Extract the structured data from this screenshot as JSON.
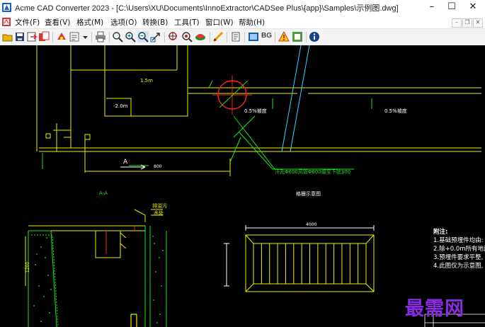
{
  "window": {
    "title": "Acme CAD Converter 2023 - [C:\\Users\\XU\\Documents\\InnoExtractor\\CADSee Plus\\{app}\\Samples\\示例图.dwg]",
    "minimize_glyph": "–",
    "maximize_glyph": "☐",
    "close_glyph": "✕"
  },
  "menu": {
    "items": [
      {
        "label": "文件(F)"
      },
      {
        "label": "查看(V)"
      },
      {
        "label": "格式(M)"
      },
      {
        "label": "选项(O)"
      },
      {
        "label": "转换(B)"
      },
      {
        "label": "工具(T)"
      },
      {
        "label": "窗口(W)"
      },
      {
        "label": "帮助(H)"
      }
    ],
    "mdi_controls": [
      "–",
      "❐",
      "✕"
    ]
  },
  "toolbar": {
    "icons": [
      "open-icon",
      "save-icon",
      "export-icon",
      "batch-icon",
      "print-preview-icon",
      "print-icon",
      "zoom-realtime-icon",
      "zoom-in-icon",
      "zoom-out-icon",
      "zoom-window-icon",
      "zoom-extent-icon",
      "pan-icon",
      "find-icon",
      "layer-icon",
      "text-icon",
      "measure-icon",
      "info-icon"
    ],
    "bg_label": "BG"
  },
  "drawing": {
    "labels": {
      "dim_1_5m": "1.5m",
      "dim_2_0m": "-2.0m",
      "slope_left": "0.5%坡度",
      "slope_right": "0.5%坡度",
      "section_a": "A",
      "section_aa": "A-A",
      "pipe_note": "汗孔Φ600风管Φ600接至下弦300",
      "grate_title": "格栅示意图",
      "drain_label_1": "排溢污",
      "drain_label_2": "水处",
      "vert_dim": "1200",
      "dim_800": "800",
      "grate_width": "4000"
    },
    "notes": {
      "title": "附注:",
      "items": [
        "1.基础预埋件均由:",
        "2.除+0.0m所有地面",
        "3.预埋件要求平整,",
        "4.此图仅为示意图,"
      ]
    },
    "colors": {
      "background": "#000000",
      "line_yellow": "#f0f000",
      "line_green": "#17e817",
      "line_red": "#ff2020",
      "line_cyan": "#2fd6ff",
      "text_white": "#ffffff"
    }
  },
  "watermark": "最需网"
}
